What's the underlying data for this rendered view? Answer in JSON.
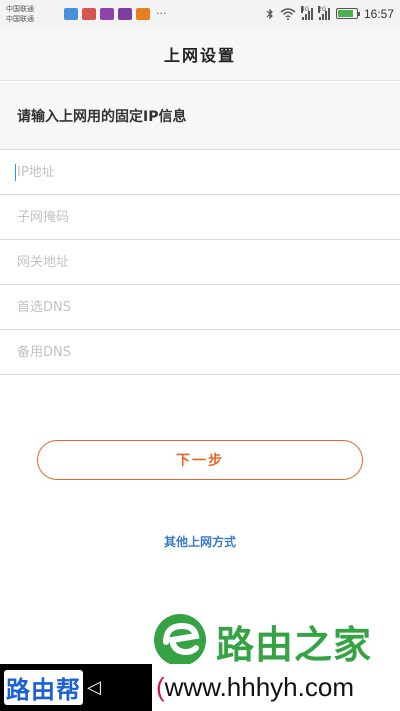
{
  "statusbar": {
    "carrier_1": "中国联通",
    "carrier_2": "中国联通",
    "more": "···",
    "net_1": "4G",
    "net_2": "2G",
    "time": "16:57",
    "battery_level": 0.85,
    "icons": [
      "bluetooth-icon",
      "wifi-icon",
      "signal-icon",
      "battery-icon"
    ]
  },
  "header": {
    "title": "上网设置"
  },
  "instruction": "请输入上网用的固定IP信息",
  "form": {
    "ip_placeholder": "IP地址",
    "subnet_placeholder": "子网掩码",
    "gateway_placeholder": "网关地址",
    "dns1_placeholder": "首选DNS",
    "dns2_placeholder": "备用DNS"
  },
  "actions": {
    "next_label": "下一步",
    "other_methods": "其他上网方式"
  },
  "watermark": {
    "brand": "路由之家",
    "bang": "路由帮",
    "url_open": "(",
    "url": "www.hhhyh.com"
  },
  "colors": {
    "accent": "#e9652c",
    "link": "#3a7bc8",
    "brand_green": "#35a244"
  }
}
